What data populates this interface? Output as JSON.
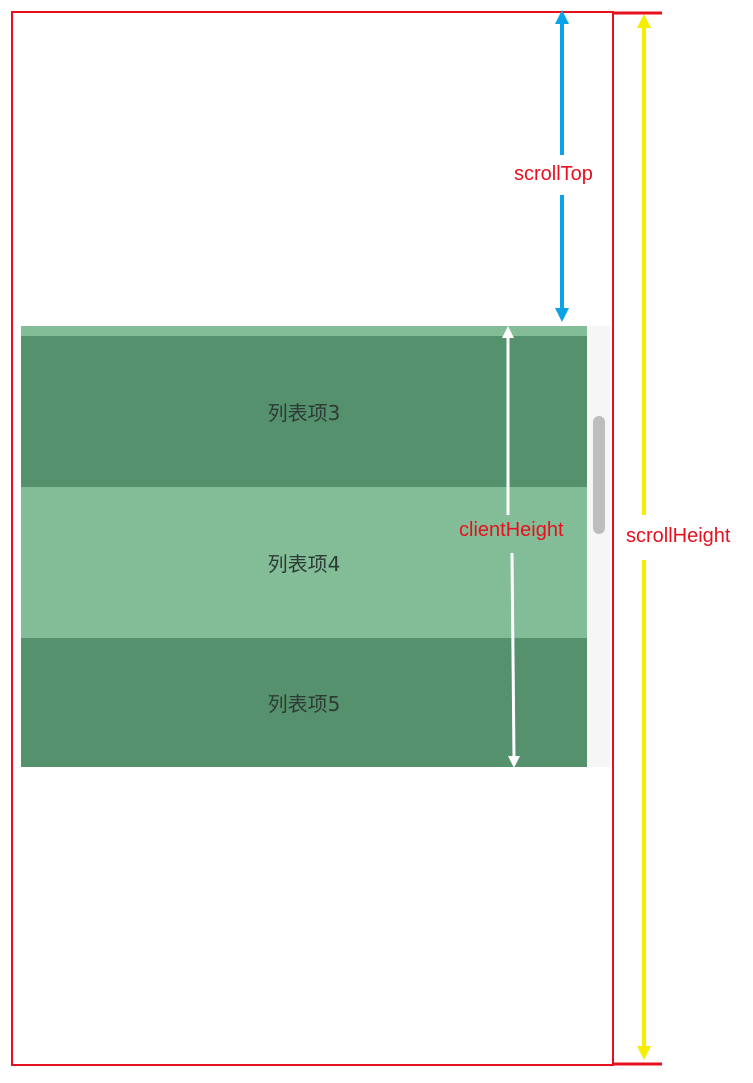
{
  "list": {
    "items": [
      {
        "label": "列表项3"
      },
      {
        "label": "列表项4"
      },
      {
        "label": "列表项5"
      }
    ]
  },
  "annotations": {
    "scroll_top": "scrollTop",
    "client_height": "clientHeight",
    "scroll_height": "scrollHeight"
  },
  "colors": {
    "frame": "#e8101f",
    "scroll_top_arrow": "#0aa3e8",
    "client_height_arrow": "#ffffff",
    "scroll_height_arrow": "#f5ee00",
    "label": "#e8101f",
    "item_dark": "#54916c",
    "item_light": "#82bd97"
  }
}
